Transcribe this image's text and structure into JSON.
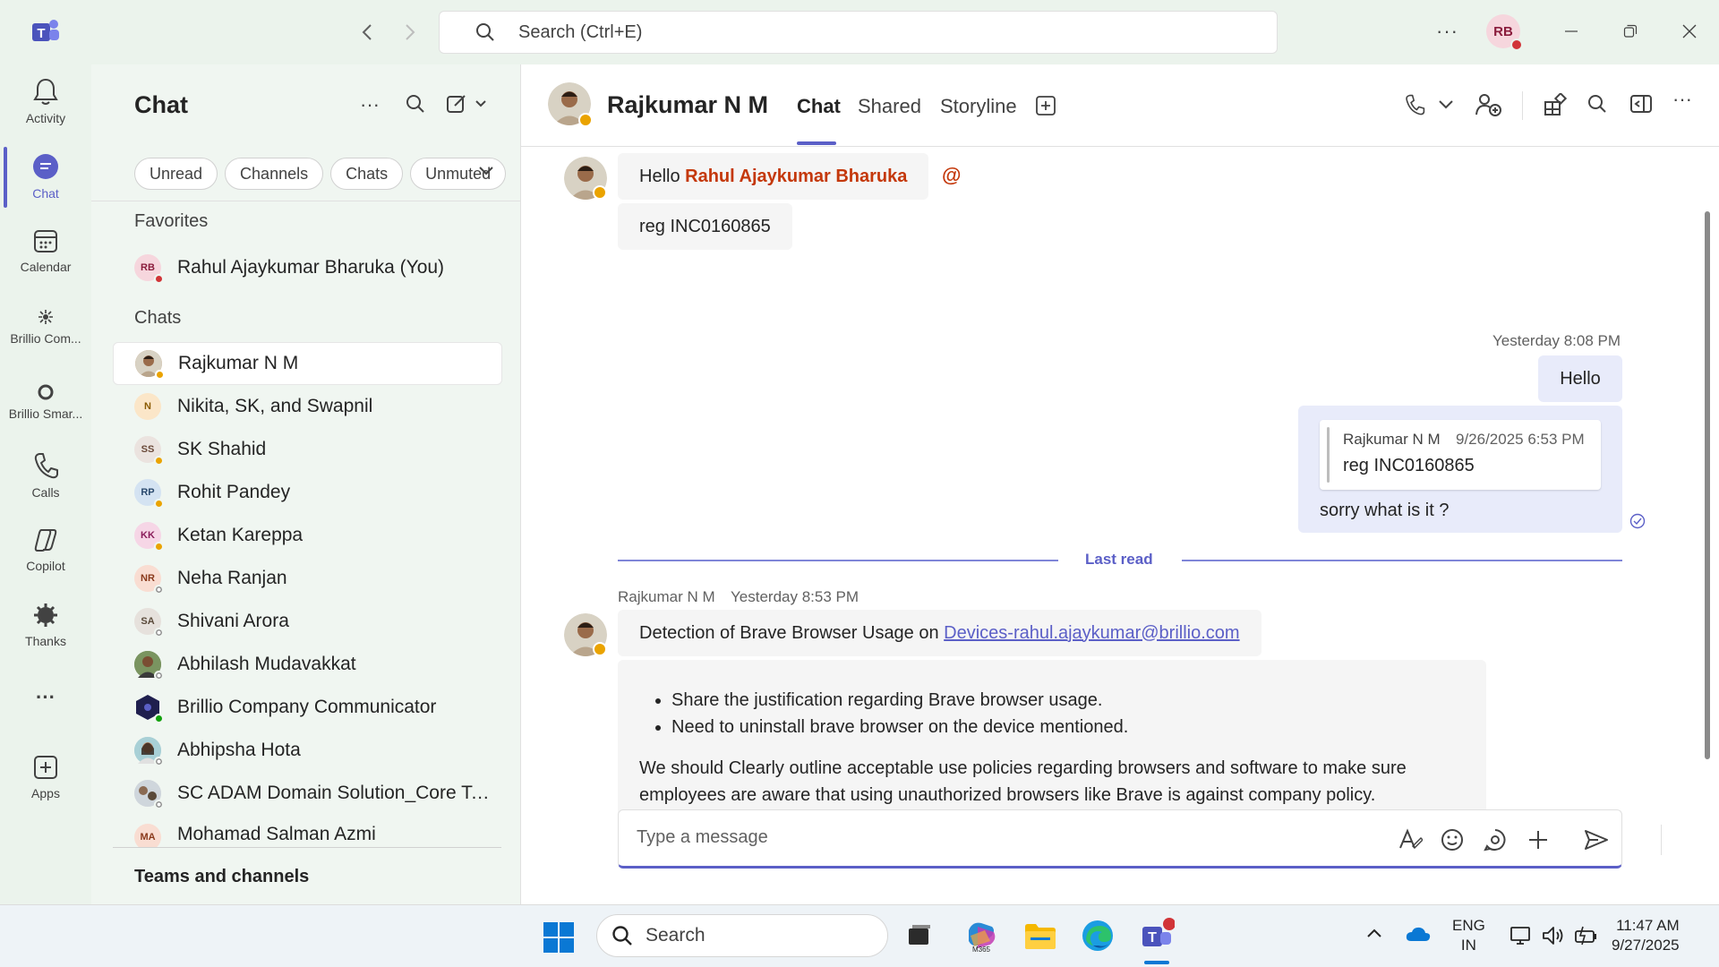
{
  "titlebar": {
    "search_placeholder": "Search (Ctrl+E)",
    "user_initials": "RB",
    "more": "···"
  },
  "rail": {
    "items": [
      {
        "label": "Activity",
        "icon": "bell-icon"
      },
      {
        "label": "Chat",
        "icon": "chat-icon"
      },
      {
        "label": "Calendar",
        "icon": "calendar-icon"
      },
      {
        "label": "Brillio Com...",
        "icon": "brillio-comms-icon"
      },
      {
        "label": "Brillio Smar...",
        "icon": "brillio-smart-icon"
      },
      {
        "label": "Calls",
        "icon": "phone-icon"
      },
      {
        "label": "Copilot",
        "icon": "copilot-icon"
      },
      {
        "label": "Thanks",
        "icon": "thanks-icon"
      },
      {
        "label": "···",
        "icon": "more-icon"
      },
      {
        "label": "Apps",
        "icon": "apps-icon"
      }
    ]
  },
  "chatlist": {
    "title": "Chat",
    "filters": [
      "Unread",
      "Channels",
      "Chats",
      "Unmuted"
    ],
    "favorites_label": "Favorites",
    "favorites": [
      {
        "name": "Rahul Ajaykumar Bharuka (You)",
        "initials": "RB",
        "status": "busy"
      }
    ],
    "chats_label": "Chats",
    "chats": [
      {
        "name": "Rajkumar N M",
        "initials": "",
        "status": "away",
        "photo": true
      },
      {
        "name": "Nikita, SK, and Swapnil",
        "initials": "N",
        "status": "",
        "group": true
      },
      {
        "name": "SK Shahid",
        "initials": "SS",
        "status": "away"
      },
      {
        "name": "Rohit Pandey",
        "initials": "RP",
        "status": "away"
      },
      {
        "name": "Ketan Kareppa",
        "initials": "KK",
        "status": "away"
      },
      {
        "name": "Neha Ranjan",
        "initials": "NR",
        "status": "off"
      },
      {
        "name": "Shivani Arora",
        "initials": "SA",
        "status": "off"
      },
      {
        "name": "Abhilash Mudavakkat",
        "initials": "",
        "status": "off",
        "photo": true
      },
      {
        "name": "Brillio Company Communicator",
        "initials": "",
        "status": "avail",
        "bot": true
      },
      {
        "name": "Abhipsha Hota",
        "initials": "",
        "status": "off",
        "photo": true
      },
      {
        "name": "SC ADAM Domain Solution_Core Tea...",
        "initials": "",
        "status": "",
        "group": true
      },
      {
        "name": "Mohamad Salman Azmi",
        "initials": "MA",
        "status": ""
      }
    ],
    "teams_channels_label": "Teams and channels"
  },
  "conversation": {
    "name": "Rajkumar N M",
    "tabs": [
      "Chat",
      "Shared",
      "Storyline"
    ],
    "messages": {
      "m1_greeting": "Hello ",
      "m1_mention": "Rahul Ajaykumar Bharuka",
      "m1_at": "@",
      "m2_text": "reg INC0160865",
      "my_time": "Yesterday 8:08 PM",
      "my_hello": "Hello",
      "quote_author": "Rajkumar N M",
      "quote_time": "9/26/2025 6:53 PM",
      "quote_text": "reg INC0160865",
      "my_reply": "sorry what is it ?",
      "last_read": "Last read",
      "m3_author": "Rajkumar N M",
      "m3_time": "Yesterday 8:53 PM",
      "m3_text": "Detection of Brave Browser Usage on ",
      "m3_link": "Devices-rahul.ajaykumar@brillio.com",
      "m4_bullets": [
        "Share the justification regarding Brave browser usage.",
        "Need to uninstall brave browser on the device mentioned."
      ],
      "m4_para": "We should Clearly outline acceptable use policies regarding browsers and software to make sure employees are aware that using unauthorized browsers like Brave is against company policy."
    },
    "compose_placeholder": "Type a message"
  },
  "taskbar": {
    "search_label": "Search",
    "lang_line1": "ENG",
    "lang_line2": "IN",
    "time": "11:47 AM",
    "date": "9/27/2025",
    "m365_label": "M365"
  },
  "colors": {
    "accent": "#5b5fc7",
    "mention": "#c4380b",
    "rail_bg": "#ebf3ec",
    "my_bubble": "#e8ebfa",
    "away": "#eaa300",
    "busy": "#d13438",
    "available": "#13a10e"
  }
}
